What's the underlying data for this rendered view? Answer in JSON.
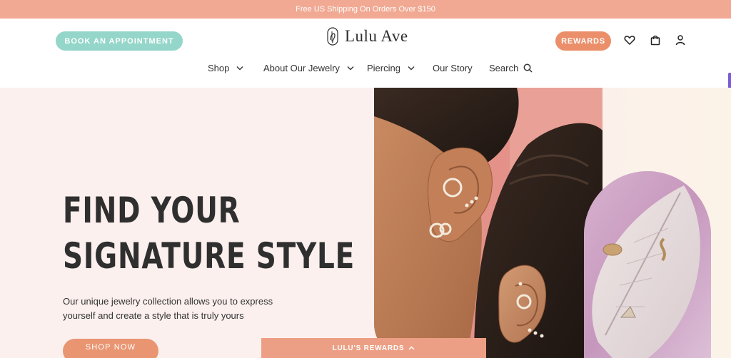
{
  "promo_bar": {
    "text": "Free US Shipping On Orders Over $150"
  },
  "header": {
    "book_button": "BOOK AN APPOINTMENT",
    "logo_text": "Lulu Ave",
    "rewards_button": "REWARDS"
  },
  "nav": {
    "items": [
      {
        "label": "Shop"
      },
      {
        "label": "About Our Jewelry"
      },
      {
        "label": "Piercing"
      },
      {
        "label": "Our Story"
      },
      {
        "label": "Search"
      }
    ]
  },
  "hero": {
    "title_line1": "FIND YOUR",
    "title_line2": "SIGNATURE STYLE",
    "subtitle": "Our unique jewelry collection allows you to express yourself and create a style that is truly yours",
    "cta": "SHOP NOW"
  },
  "rewards_drawer": {
    "label": "LULU'S REWARDS"
  },
  "colors": {
    "promo": "#f1a993",
    "book_button": "#94d6c9",
    "rewards_button": "#eb8f6a",
    "hero_bg": "#fbf0ee",
    "shop_button": "#e99572"
  },
  "icons": [
    "heart-icon",
    "shopping-bag-icon",
    "user-icon",
    "search-icon",
    "chevron-down-icon",
    "chevron-up-icon"
  ]
}
